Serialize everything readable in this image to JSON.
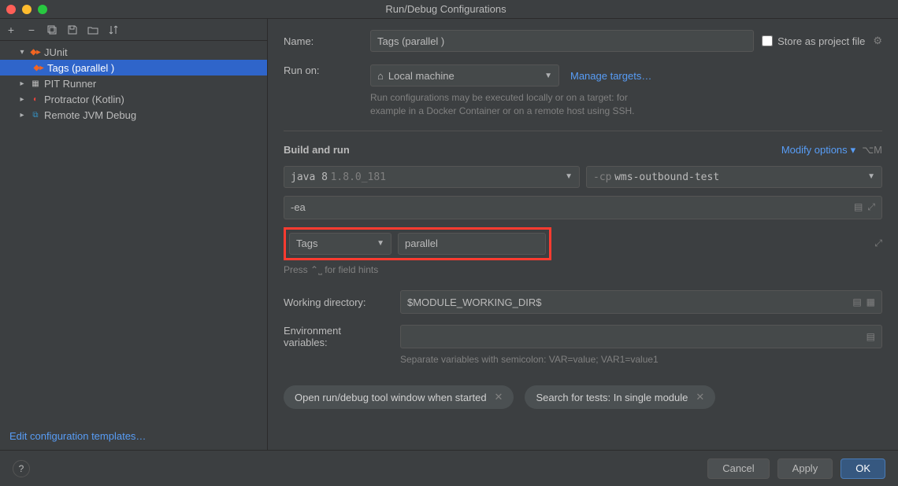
{
  "window": {
    "title": "Run/Debug Configurations"
  },
  "tree": {
    "items": [
      {
        "label": "JUnit",
        "expanded": true,
        "icon": "junit"
      },
      {
        "label": "Tags (parallel )",
        "selected": true,
        "child": true,
        "icon": "junit"
      },
      {
        "label": "PIT Runner",
        "icon": "pit"
      },
      {
        "label": "Protractor (Kotlin)",
        "icon": "protractor"
      },
      {
        "label": "Remote JVM Debug",
        "icon": "remote"
      }
    ],
    "edit_templates": "Edit configuration templates…"
  },
  "form": {
    "name_label": "Name:",
    "name_value": "Tags (parallel )",
    "store_label": "Store as project file",
    "run_on_label": "Run on:",
    "run_on_value": "Local machine",
    "manage_targets": "Manage targets…",
    "run_on_hint1": "Run configurations may be executed locally or on a target: for",
    "run_on_hint2": "example in a Docker Container or on a remote host using SSH.",
    "build_run": "Build and run",
    "modify_options": "Modify options",
    "modify_shortcut": "⌥M",
    "java_version": "java 8",
    "java_build": "1.8.0_181",
    "cp_prefix": "-cp",
    "cp_module": "wms-outbound-test",
    "vm_options": "-ea",
    "tags_label": "Tags",
    "tags_value": "parallel",
    "tags_hint": "Press ⌃⎵ for field hints",
    "wd_label": "Working directory:",
    "wd_value": "$MODULE_WORKING_DIR$",
    "env_label": "Environment variables:",
    "env_hint": "Separate variables with semicolon: VAR=value; VAR1=value1",
    "chip1": "Open run/debug tool window when started",
    "chip2": "Search for tests: In single module"
  },
  "footer": {
    "cancel": "Cancel",
    "apply": "Apply",
    "ok": "OK"
  }
}
